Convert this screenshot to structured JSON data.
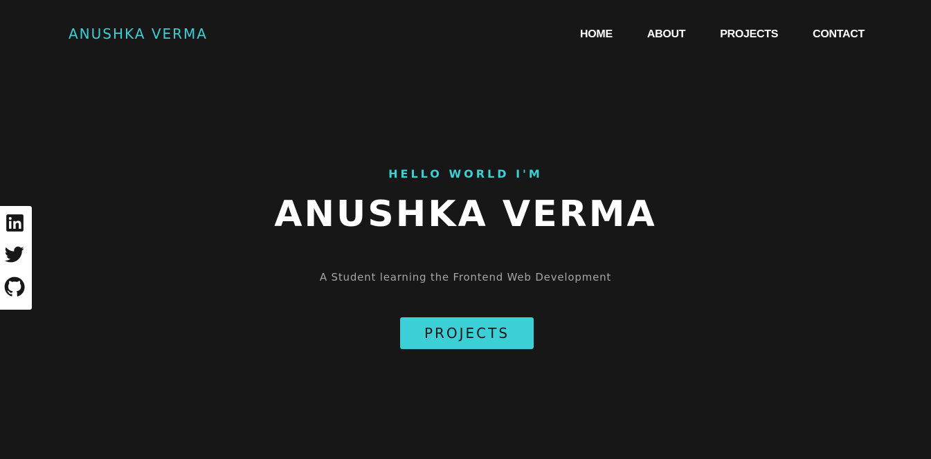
{
  "header": {
    "brand": "ANUSHKA VERMA",
    "nav": [
      {
        "label": "HOME"
      },
      {
        "label": "ABOUT"
      },
      {
        "label": "PROJECTS"
      },
      {
        "label": "CONTACT"
      }
    ]
  },
  "social": [
    {
      "icon": "linkedin-icon"
    },
    {
      "icon": "twitter-icon"
    },
    {
      "icon": "github-icon"
    }
  ],
  "hero": {
    "greeting": "HELLO WORLD I'M",
    "name": "ANUSHKA VERMA",
    "tagline": "A Student learning the Frontend Web Development",
    "cta_label": "PROJECTS"
  },
  "colors": {
    "background": "#171717",
    "accent": "#3ccfd6",
    "text": "#ffffff",
    "muted": "#a6a6a6"
  }
}
